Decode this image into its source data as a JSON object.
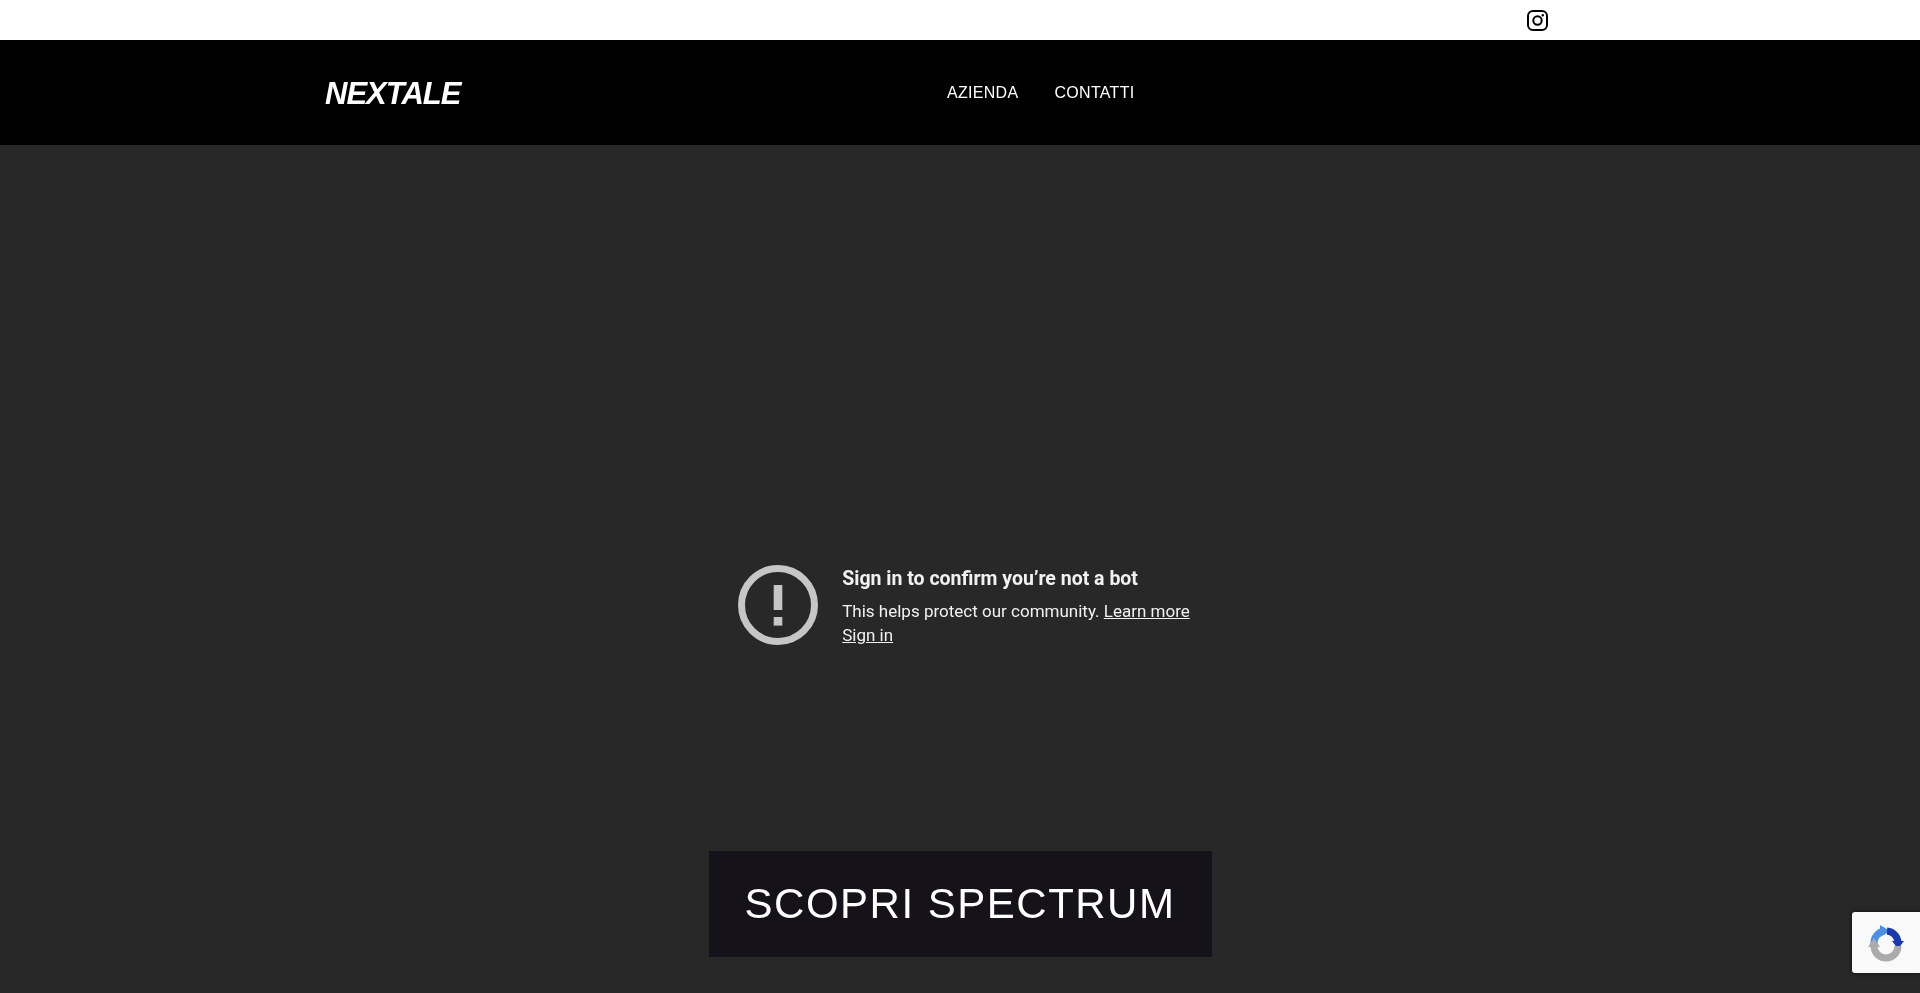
{
  "header": {
    "logo": "NEXTALE",
    "nav": [
      {
        "label": "AZIENDA"
      },
      {
        "label": "CONTATTI"
      }
    ]
  },
  "notice": {
    "title": "Sign in to confirm you’re not a bot",
    "message": "This helps protect our community.",
    "learn_more_link": "Learn more",
    "sign_in_link": "Sign in"
  },
  "cta_button": "SCOPRI SPECTRUM"
}
